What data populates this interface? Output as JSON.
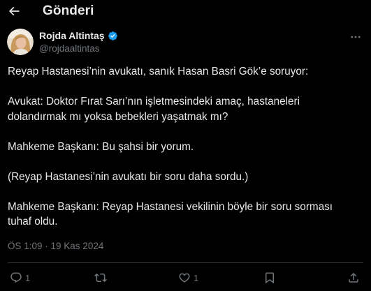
{
  "header": {
    "title": "Gönderi"
  },
  "author": {
    "name": "Rojda Altintaş",
    "handle": "@rojdaaltintas",
    "verified": true
  },
  "tweet": {
    "paragraphs": [
      "Reyap Hastanesi’nin avukatı, sanık Hasan Basri Gök’e soruyor:",
      "Avukat: Doktor Fırat Sarı’nın işletmesindeki amaç, hastaneleri\ndolandırmak mı yoksa bebekleri yaşatmak mı?",
      "Mahkeme Başkanı: Bu şahsi bir yorum.",
      "(Reyap Hastanesi’nin avukatı bir soru daha sordu.)",
      "Mahkeme Başkanı: Reyap Hastanesi vekilinin böyle bir soru sorması\ntuhaf oldu."
    ],
    "timestamp": "ÖS 1:09 · 19 Kas 2024"
  },
  "actions": {
    "reply_count": "1",
    "retweet_count": "",
    "like_count": "1"
  },
  "colors": {
    "background": "#000000",
    "text_primary": "#e7e9ea",
    "text_secondary": "#71767b",
    "divider": "#2f3336",
    "verified": "#1d9bf0"
  },
  "icons": {
    "back": "arrow-left-icon",
    "verified": "verified-badge-icon",
    "more": "more-horizontal-icon",
    "reply": "reply-icon",
    "retweet": "retweet-icon",
    "like": "heart-icon",
    "bookmark": "bookmark-icon",
    "share": "share-icon"
  }
}
